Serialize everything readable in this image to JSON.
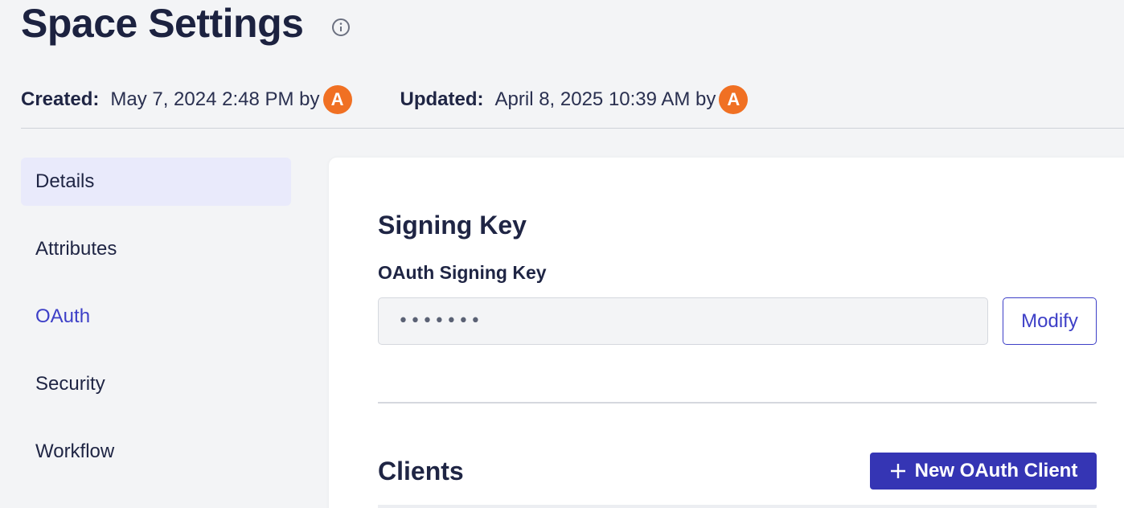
{
  "header": {
    "title": "Space Settings",
    "info_icon": "info-circle-icon",
    "created_label": "Created:",
    "created_value": "May 7, 2024 2:48 PM by",
    "created_avatar": "A",
    "updated_label": "Updated:",
    "updated_value": "April 8, 2025 10:39 AM by",
    "updated_avatar": "A",
    "avatar_color": "#f07023"
  },
  "sidebar": {
    "items": [
      {
        "label": "Details",
        "state": "selected"
      },
      {
        "label": "Attributes",
        "state": "normal"
      },
      {
        "label": "OAuth",
        "state": "active"
      },
      {
        "label": "Security",
        "state": "normal"
      },
      {
        "label": "Workflow",
        "state": "normal"
      }
    ]
  },
  "main": {
    "signing_key_title": "Signing Key",
    "field_label": "OAuth Signing Key",
    "key_value": "•••••••",
    "modify_label": "Modify",
    "clients_title": "Clients",
    "new_client_label": "New OAuth Client",
    "accent_color": "#3535b4"
  }
}
